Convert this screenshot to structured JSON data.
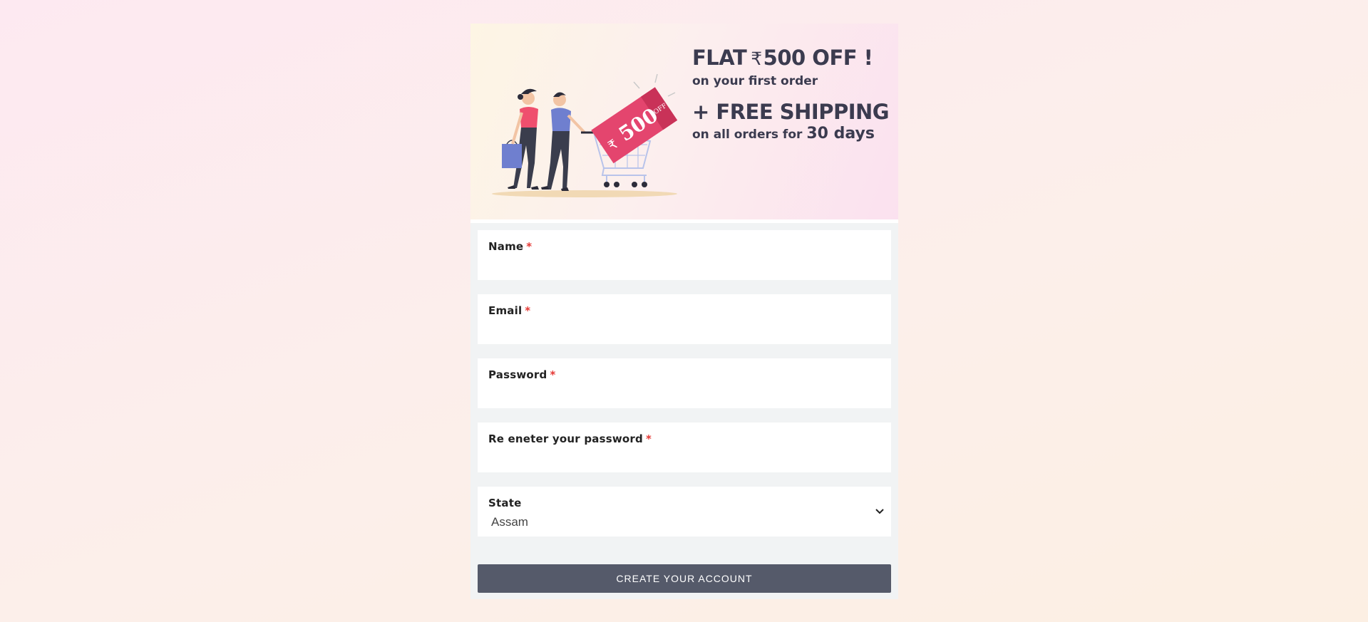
{
  "promo": {
    "line1_prefix": "FLAT",
    "currency_symbol": "₹",
    "line1_amount": "500 OFF !",
    "line2": "on your first order",
    "line3": "+ FREE SHIPPING",
    "line4_prefix": "on all orders for",
    "line4_days": "30 days",
    "tag_amount": "500",
    "tag_off": "OFF",
    "tag_currency": "₹"
  },
  "form": {
    "fields": [
      {
        "label": "Name",
        "required_mark": "*",
        "value": ""
      },
      {
        "label": "Email",
        "required_mark": "*",
        "value": ""
      },
      {
        "label": "Password",
        "required_mark": "*",
        "value": ""
      },
      {
        "label": "Re eneter your password",
        "required_mark": "*",
        "value": ""
      }
    ],
    "state": {
      "label": "State",
      "selected": "Assam"
    },
    "submit_label": "CREATE YOUR ACCOUNT"
  },
  "colors": {
    "button_bg": "#555a6a",
    "required": "#e53935",
    "tag_pink": "#e4456e",
    "headline": "#3b3b4f"
  },
  "icons": [
    "shopping-couple-illustration",
    "price-tag-icon",
    "shopping-cart-icon",
    "chevron-down-icon"
  ]
}
